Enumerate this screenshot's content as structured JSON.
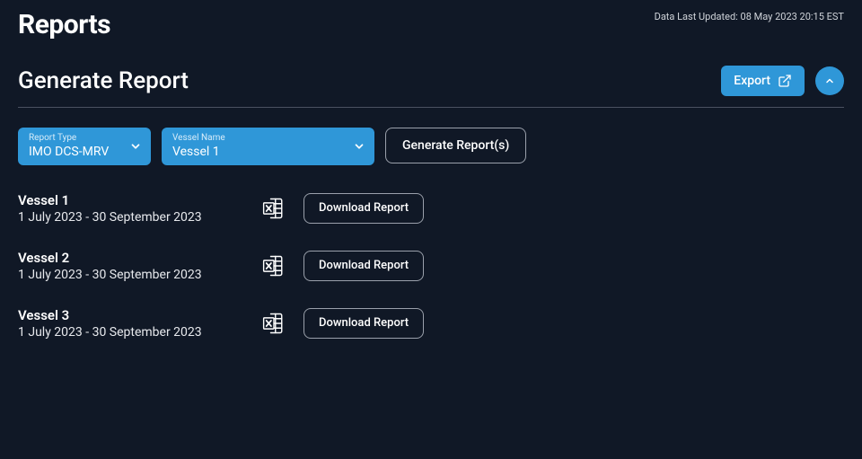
{
  "header": {
    "title": "Reports",
    "last_updated": "Data Last Updated: 08 May 2023 20:15 EST"
  },
  "section": {
    "title": "Generate Report",
    "export_label": "Export"
  },
  "controls": {
    "report_type": {
      "label": "Report Type",
      "value": "IMO DCS-MRV"
    },
    "vessel_name": {
      "label": "Vessel Name",
      "value": "Vessel 1"
    },
    "generate_label": "Generate Report(s)"
  },
  "reports": [
    {
      "name": "Vessel 1",
      "range": "1 July 2023 - 30 September 2023",
      "download_label": "Download Report"
    },
    {
      "name": "Vessel 2",
      "range": "1 July 2023 - 30 September 2023",
      "download_label": "Download Report"
    },
    {
      "name": "Vessel 3",
      "range": "1 July 2023 - 30 September 2023",
      "download_label": "Download Report"
    }
  ]
}
